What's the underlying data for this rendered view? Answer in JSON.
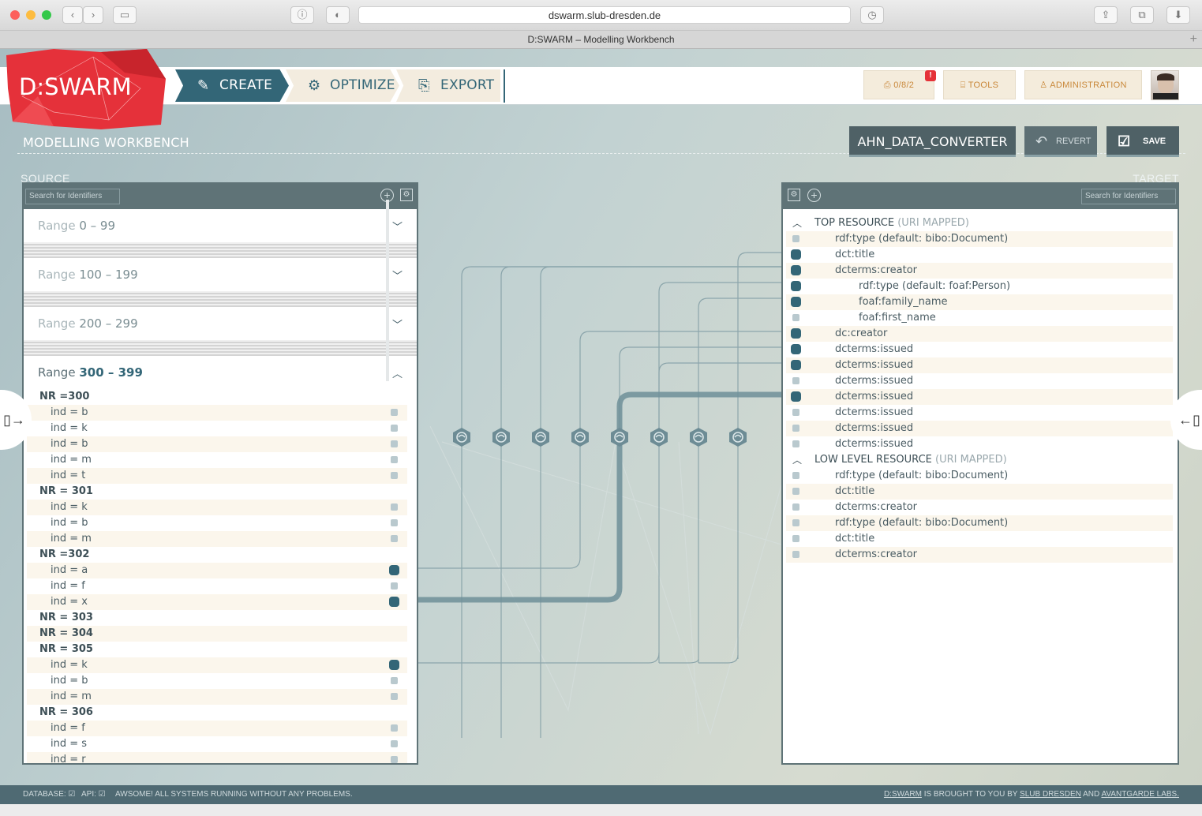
{
  "browser": {
    "url": "dswarm.slub-dresden.de",
    "tab_title": "D:SWARM – Modelling Workbench"
  },
  "app": {
    "logo": "D:SWARM"
  },
  "nav": {
    "create": "CREATE",
    "optimize": "OPTIMIZE",
    "export": "EXPORT"
  },
  "header_right": {
    "counter": "0/8/2",
    "badge": "!",
    "tools": "TOOLS",
    "administration": "ADMINISTRATION"
  },
  "page": {
    "title": "MODELLING WORKBENCH",
    "project_name": "AHN_DATA_CONVERTER",
    "revert": "REVERT",
    "save": "SAVE"
  },
  "source": {
    "label": "SOURCE",
    "search_placeholder": "Search for Identifiers",
    "ranges": [
      {
        "prefix": "Range",
        "value": "0 – 99",
        "expanded": false
      },
      {
        "prefix": "Range",
        "value": "100 – 199",
        "expanded": false
      },
      {
        "prefix": "Range",
        "value": "200 – 299",
        "expanded": false
      },
      {
        "prefix": "Range",
        "value": "300 – 399",
        "expanded": true
      }
    ],
    "rows": [
      {
        "text": "NR =300",
        "kind": "group"
      },
      {
        "text": "ind = b",
        "kind": "item",
        "mapped": false
      },
      {
        "text": "ind = k",
        "kind": "item",
        "mapped": false
      },
      {
        "text": "ind = b",
        "kind": "item",
        "mapped": false
      },
      {
        "text": "ind = m",
        "kind": "item",
        "mapped": false
      },
      {
        "text": "ind = t",
        "kind": "item",
        "mapped": false
      },
      {
        "text": "NR = 301",
        "kind": "group"
      },
      {
        "text": "ind = k",
        "kind": "item",
        "mapped": false
      },
      {
        "text": "ind = b",
        "kind": "item",
        "mapped": false
      },
      {
        "text": "ind = m",
        "kind": "item",
        "mapped": false
      },
      {
        "text": "NR =302",
        "kind": "group"
      },
      {
        "text": "ind = a",
        "kind": "item",
        "mapped": true
      },
      {
        "text": "ind = f",
        "kind": "item",
        "mapped": false
      },
      {
        "text": "ind = x",
        "kind": "item",
        "mapped": true
      },
      {
        "text": "NR = 303",
        "kind": "group"
      },
      {
        "text": "NR = 304",
        "kind": "group"
      },
      {
        "text": "NR = 305",
        "kind": "group"
      },
      {
        "text": "ind = k",
        "kind": "item",
        "mapped": true
      },
      {
        "text": "ind = b",
        "kind": "item",
        "mapped": false
      },
      {
        "text": "ind = m",
        "kind": "item",
        "mapped": false
      },
      {
        "text": "NR = 306",
        "kind": "group"
      },
      {
        "text": "ind = f",
        "kind": "item",
        "mapped": false
      },
      {
        "text": "ind = s",
        "kind": "item",
        "mapped": false
      },
      {
        "text": "ind = r",
        "kind": "item",
        "mapped": false
      }
    ]
  },
  "target": {
    "label": "TARGET",
    "search_placeholder": "Search for Identifiers",
    "rows": [
      {
        "text": "TOP RESOURCE",
        "suffix": "(URI MAPPED)",
        "kind": "header"
      },
      {
        "text": "rdf:type (default: bibo:Document)",
        "level": 1,
        "mapped": false
      },
      {
        "text": "dct:title",
        "level": 1,
        "mapped": true
      },
      {
        "text": "dcterms:creator",
        "level": 1,
        "mapped": true
      },
      {
        "text": "rdf:type (default: foaf:Person)",
        "level": 2,
        "mapped": true
      },
      {
        "text": "foaf:family_name",
        "level": 2,
        "mapped": true
      },
      {
        "text": "foaf:first_name",
        "level": 2,
        "mapped": false
      },
      {
        "text": "dc:creator",
        "level": 1,
        "mapped": true
      },
      {
        "text": "dcterms:issued",
        "level": 1,
        "mapped": true
      },
      {
        "text": "dcterms:issued",
        "level": 1,
        "mapped": true
      },
      {
        "text": "dcterms:issued",
        "level": 1,
        "mapped": false
      },
      {
        "text": "dcterms:issued",
        "level": 1,
        "mapped": true
      },
      {
        "text": "dcterms:issued",
        "level": 1,
        "mapped": false
      },
      {
        "text": "dcterms:issued",
        "level": 1,
        "mapped": false
      },
      {
        "text": "dcterms:issued",
        "level": 1,
        "mapped": false
      },
      {
        "text": "LOW LEVEL RESOURCE",
        "suffix": "(URI MAPPED)",
        "kind": "header"
      },
      {
        "text": "rdf:type (default: bibo:Document)",
        "level": 1,
        "mapped": false
      },
      {
        "text": "dct:title",
        "level": 1,
        "mapped": false
      },
      {
        "text": "dcterms:creator",
        "level": 1,
        "mapped": false
      },
      {
        "text": "rdf:type (default: bibo:Document)",
        "level": 1,
        "mapped": false
      },
      {
        "text": "dct:title",
        "level": 1,
        "mapped": false
      },
      {
        "text": "dcterms:creator",
        "level": 1,
        "mapped": false
      }
    ]
  },
  "footer": {
    "db": "DATABASE:",
    "api": "API:",
    "status": "AWSOME! ALL SYSTEMS RUNNING WITHOUT ANY PROBLEMS.",
    "credit_brand": "D:SWARM",
    "credit_mid": "IS BROUGHT TO YOU BY",
    "credit_org1": "SLUB DRESDEN",
    "credit_and": "AND",
    "credit_org2": "AVANTGARDE LABS."
  },
  "colors": {
    "accent": "#336677",
    "panel": "#5f7377",
    "cream": "#f4ecdc",
    "logo_red": "#e5313a"
  }
}
